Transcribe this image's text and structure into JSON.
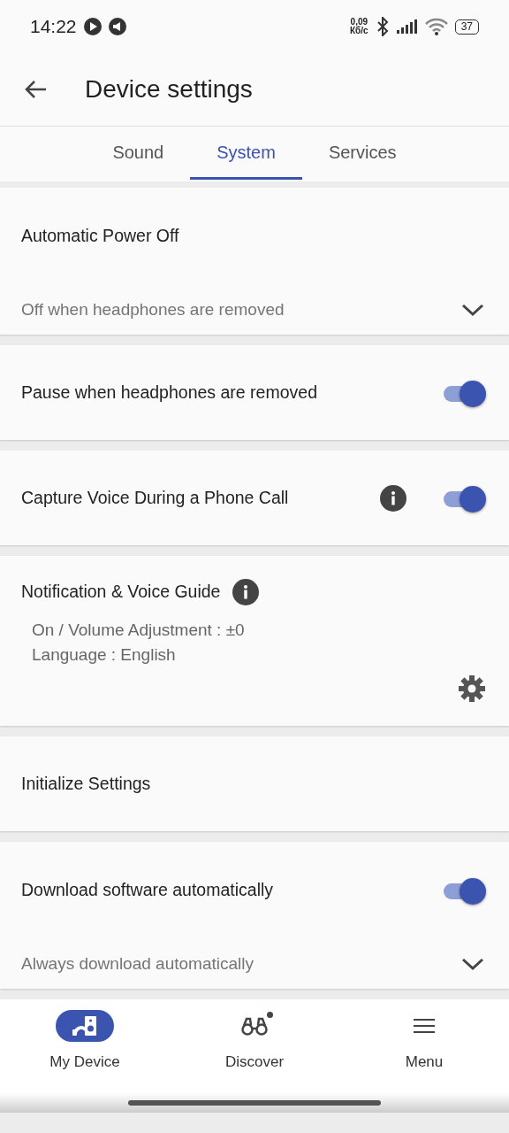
{
  "status_bar": {
    "time": "14:22",
    "speed_value": "0,09",
    "speed_unit": "Кб/с",
    "battery": "37"
  },
  "header": {
    "title": "Device settings"
  },
  "tabs": [
    {
      "label": "Sound",
      "selected": false
    },
    {
      "label": "System",
      "selected": true
    },
    {
      "label": "Services",
      "selected": false
    }
  ],
  "sections": [
    {
      "title": "Automatic Power Off",
      "dropdown_value": "Off when headphones are removed"
    },
    {
      "title": "Pause when headphones are removed",
      "toggle": {
        "on": true
      }
    },
    {
      "title": "Capture Voice During a Phone Call",
      "info": true,
      "toggle": {
        "on": true
      }
    },
    {
      "title": "Notification & Voice Guide",
      "title_info": true,
      "details": [
        "On / Volume Adjustment : ±0",
        "Language : English"
      ],
      "settings": true
    },
    {
      "title": "Initialize Settings"
    },
    {
      "title": "Download software automatically",
      "toggle": {
        "on": true
      },
      "dropdown_value": "Always download automatically"
    }
  ],
  "bottom_nav": [
    {
      "label": "My Device",
      "selected": true,
      "kind": "device",
      "badge": false
    },
    {
      "label": "Discover",
      "selected": false,
      "kind": "discover",
      "badge": true
    },
    {
      "label": "Menu",
      "selected": false,
      "kind": "menu",
      "badge": false
    }
  ]
}
